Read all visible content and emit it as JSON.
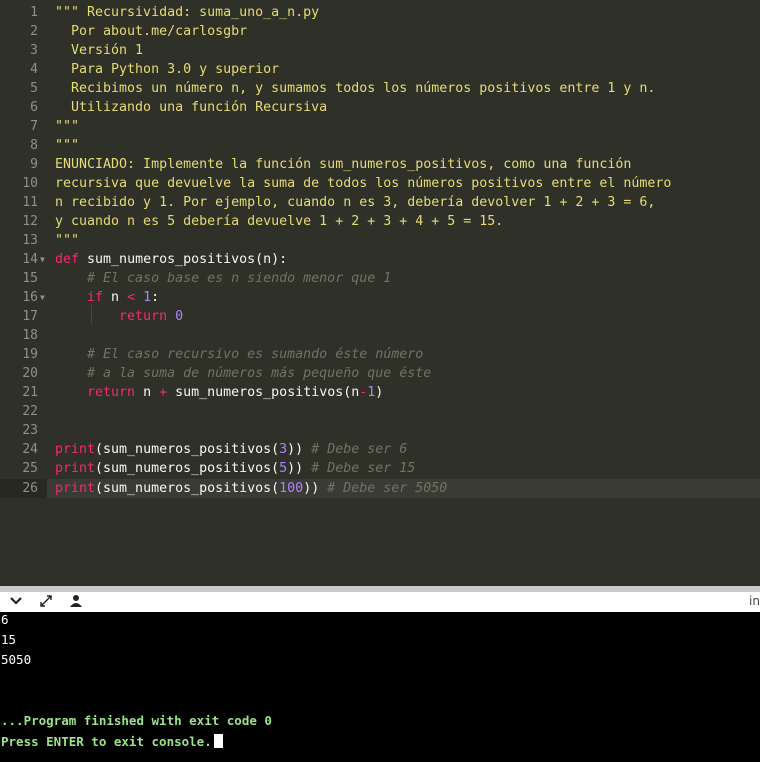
{
  "editor": {
    "line_numbers": [
      "1",
      "2",
      "3",
      "4",
      "5",
      "6",
      "7",
      "8",
      "9",
      "10",
      "11",
      "12",
      "13",
      "14",
      "15",
      "16",
      "17",
      "18",
      "19",
      "20",
      "21",
      "22",
      "23",
      "24",
      "25",
      "26"
    ],
    "lines": {
      "l1": "\"\"\" Recursividad: suma_uno_a_n.py",
      "l2": "  Por about.me/carlosgbr",
      "l3": "  Versión 1",
      "l4": "  Para Python 3.0 y superior",
      "l5": "  Recibimos un número n, y sumamos todos los números positivos entre 1 y n.",
      "l6": "  Utilizando una función Recursiva",
      "l7": "\"\"\"",
      "l8": "\"\"\"",
      "l9": "ENUNCIADO: Implemente la función sum_numeros_positivos, como una función",
      "l10": "recursiva que devuelve la suma de todos los números positivos entre el número",
      "l11": "n recibido y 1. Por ejemplo, cuando n es 3, debería devolver 1 + 2 + 3 = 6,",
      "l12": "y cuando n es 5 debería devuelve 1 + 2 + 3 + 4 + 5 = 15.",
      "l13": "\"\"\"",
      "l14_def": "def",
      "l14_name": " sum_numeros_positivos",
      "l14_rest": "(n):",
      "l15": "    # El caso base es n siendo menor que 1",
      "l16_if": "    if",
      "l16_a": " n ",
      "l16_op": "<",
      "l16_sp": " ",
      "l16_num": "1",
      "l16_end": ":",
      "l17_ret": "        return",
      "l17_sp": " ",
      "l17_num": "0",
      "l19": "    # El caso recursivo es sumando éste número",
      "l20": "    # a la suma de números más pequeño que éste",
      "l21_ret": "    return",
      "l21_a": " n ",
      "l21_op": "+",
      "l21_b": " sum_numeros_positivos(n",
      "l21_minus": "-",
      "l21_num": "1",
      "l21_end": ")",
      "l24_print": "print",
      "l24_a": "(sum_numeros_positivos(",
      "l24_num": "3",
      "l24_b": ")) ",
      "l24_c": "# Debe ser 6",
      "l25_print": "print",
      "l25_a": "(sum_numeros_positivos(",
      "l25_num": "5",
      "l25_b": ")) ",
      "l25_c": "# Debe ser 15",
      "l26_print": "print",
      "l26_a": "(sum_numeros_positivos(",
      "l26_num": "100",
      "l26_b": ")) ",
      "l26_c": "# Debe ser 5050"
    }
  },
  "toolbar": {
    "collapse_icon": "chevron-down-icon",
    "expand_icon": "expand-arrows-icon",
    "user_icon": "user-icon",
    "right_text": "in"
  },
  "console": {
    "output": [
      "6",
      "15",
      "5050"
    ],
    "finished": "...Program finished with exit code 0",
    "press_enter": "Press ENTER to exit console."
  },
  "colors": {
    "editor_bg": "#2f3129",
    "string": "#e6db74",
    "keyword": "#f92672",
    "builtin": "#66d9ef",
    "number": "#ae81ff",
    "comment": "#75715e",
    "console_green": "#9be38a"
  }
}
